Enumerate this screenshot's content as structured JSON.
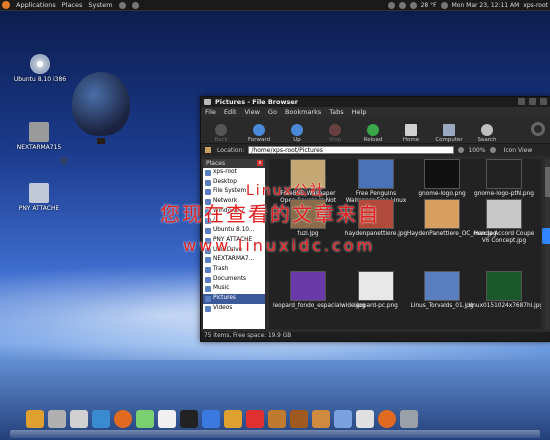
{
  "top_panel": {
    "menus": [
      "Applications",
      "Places",
      "System"
    ],
    "weather": "28 °F",
    "datetime": "Mon Mar 23, 12:11 AM",
    "user": "xps-root"
  },
  "desktop_icons": [
    {
      "label": "Ubuntu 8.10 i386",
      "icon": "cd-icon"
    },
    {
      "label": "NEXTARMA715",
      "icon": "drive-icon"
    },
    {
      "label": "PNY ATTACHE",
      "icon": "usb-icon"
    }
  ],
  "window": {
    "title": "Pictures - File Browser",
    "menus": [
      "File",
      "Edit",
      "View",
      "Go",
      "Bookmarks",
      "Tabs",
      "Help"
    ],
    "toolbar": [
      {
        "label": "Back",
        "icon": "back-icon",
        "enabled": false
      },
      {
        "label": "Forward",
        "icon": "forward-icon",
        "enabled": true
      },
      {
        "label": "Up",
        "icon": "up-icon",
        "enabled": true
      },
      {
        "label": "Stop",
        "icon": "stop-icon",
        "enabled": false
      },
      {
        "label": "Reload",
        "icon": "reload-icon",
        "enabled": true
      },
      {
        "label": "Home",
        "icon": "home-icon",
        "enabled": true
      },
      {
        "label": "Computer",
        "icon": "computer-icon",
        "enabled": true
      },
      {
        "label": "Search",
        "icon": "search-icon",
        "enabled": true
      }
    ],
    "location_label": "Location:",
    "location_value": "/home/xps-root/Pictures",
    "zoom": "100%",
    "view_mode": "Icon View",
    "places_header": "Places",
    "places": [
      "xps-root",
      "Desktop",
      "File System",
      "Network",
      "Windows 7",
      "/",
      "Ubuntu 8.10...",
      "PNY ATTACHE",
      "USB Drive",
      "NEXTARMA7...",
      "Trash",
      "Documents",
      "Music",
      "Pictures",
      "Videos"
    ],
    "selected_place": "Pictures",
    "files": [
      {
        "name": "FreeBSD Wallpaper Open Source Is Not Bad.jpg",
        "color": "#c4a772"
      },
      {
        "name": "Free Penguins Wallpaper Free Linux Desktop.jpg",
        "color": "#4a72b8"
      },
      {
        "name": "gnome-logo.png",
        "color": "#111111"
      },
      {
        "name": "gnome-logo-ptN.png",
        "color": "#222222"
      },
      {
        "name": "fuzi.jpg",
        "color": "#8a6b4a"
      },
      {
        "name": "haydenpanettiere.jpg",
        "color": "#b04a3a"
      },
      {
        "name": "HaydenPanettiere_OC_max.jpg",
        "color": "#d7a060"
      },
      {
        "name": "Honda Accord Coupe V6 Concept.jpg",
        "color": "#c8c8c8"
      },
      {
        "name": "leopard_fondo_espacialwide.jpg",
        "color": "#6a3aa8"
      },
      {
        "name": "leopard-pc.png",
        "color": "#e8e8e8"
      },
      {
        "name": "Linus_Torvalds_01.jpg",
        "color": "#5a7fc0"
      },
      {
        "name": "linux0151024x7687hi.jpg",
        "color": "#1a5a2a"
      }
    ],
    "status": "75 items, Free space: 19.9 GB"
  },
  "watermark": {
    "line1": "Linux公社",
    "line2": "您现在查看的文章来自",
    "line3": "www.linuxidc.com"
  },
  "dock": [
    {
      "icon": "folder-icon",
      "color": "#e0a030"
    },
    {
      "icon": "trash-icon",
      "color": "#b0b0b0"
    },
    {
      "icon": "printer-icon",
      "color": "#d0d0d0"
    },
    {
      "icon": "package-icon",
      "color": "#3a8ad0"
    },
    {
      "icon": "firefox-icon",
      "color": "#e06a20"
    },
    {
      "icon": "chat-icon",
      "color": "#7ad070"
    },
    {
      "icon": "penguin-icon",
      "color": "#f0f0f0"
    },
    {
      "icon": "terminal-icon",
      "color": "#222222"
    },
    {
      "icon": "monitor-icon",
      "color": "#3a7ae0"
    },
    {
      "icon": "folder-icon-2",
      "color": "#e0a030"
    },
    {
      "icon": "star-icon",
      "color": "#e03030"
    },
    {
      "icon": "document-icon",
      "color": "#c07a30"
    },
    {
      "icon": "books-icon",
      "color": "#a05a20"
    },
    {
      "icon": "media-icon",
      "color": "#d08a40"
    },
    {
      "icon": "files-icon",
      "color": "#7aa0e0"
    },
    {
      "icon": "rabbit-icon",
      "color": "#e0e0e0"
    },
    {
      "icon": "firefox-icon-2",
      "color": "#e06a20"
    },
    {
      "icon": "camera-icon",
      "color": "#9aa0a8"
    }
  ]
}
